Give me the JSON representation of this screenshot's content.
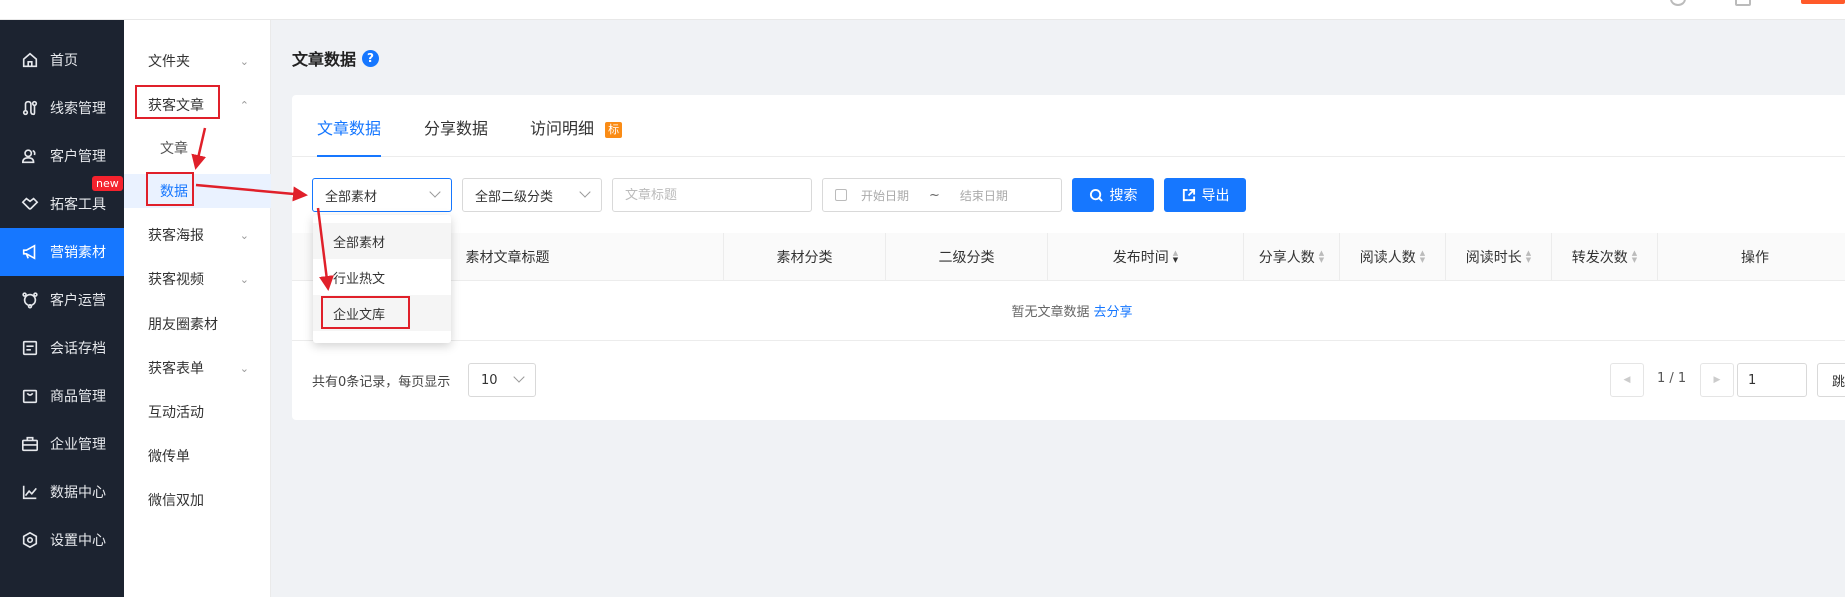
{
  "topbar": {},
  "nav": {
    "items": [
      {
        "label": "首页",
        "icon": "home-icon"
      },
      {
        "label": "线索管理",
        "icon": "route-icon"
      },
      {
        "label": "客户管理",
        "icon": "users-icon"
      },
      {
        "label": "拓客工具",
        "icon": "handshake-icon",
        "badge": "new"
      },
      {
        "label": "营销素材",
        "icon": "megaphone-icon",
        "active": true
      },
      {
        "label": "客户运营",
        "icon": "branch-icon"
      },
      {
        "label": "会话存档",
        "icon": "document-icon"
      },
      {
        "label": "商品管理",
        "icon": "bag-icon"
      },
      {
        "label": "企业管理",
        "icon": "briefcase-icon"
      },
      {
        "label": "数据中心",
        "icon": "chart-line-icon"
      },
      {
        "label": "设置中心",
        "icon": "settings-icon"
      }
    ]
  },
  "subnav": {
    "items": [
      {
        "label": "文件夹",
        "chevron": "down"
      },
      {
        "label": "获客文章",
        "chevron": "up"
      },
      {
        "label": "文章",
        "child": true
      },
      {
        "label": "数据",
        "child": true,
        "selected": true
      },
      {
        "label": "获客海报",
        "chevron": "down"
      },
      {
        "label": "获客视频",
        "chevron": "down"
      },
      {
        "label": "朋友圈素材"
      },
      {
        "label": "获客表单",
        "chevron": "down"
      },
      {
        "label": "互动活动"
      },
      {
        "label": "微传单"
      },
      {
        "label": "微信双加"
      }
    ]
  },
  "page": {
    "title": "文章数据",
    "help": "?"
  },
  "tabs": [
    {
      "label": "文章数据",
      "active": true
    },
    {
      "label": "分享数据"
    },
    {
      "label": "访问明细",
      "tag": "标"
    }
  ],
  "filters": {
    "category_value": "全部素材",
    "subcategory_value": "全部二级分类",
    "title_placeholder": "文章标题",
    "start_date_placeholder": "开始日期",
    "date_separator": "~",
    "end_date_placeholder": "结束日期",
    "search_label": "搜索",
    "export_label": "导出"
  },
  "dropdown": {
    "options": [
      "全部素材",
      "行业热文",
      "企业文库"
    ]
  },
  "table": {
    "columns": [
      "素材文章标题",
      "素材分类",
      "二级分类",
      "发布时间",
      "分享人数",
      "阅读人数",
      "阅读时长",
      "转发次数",
      "操作"
    ],
    "empty_text": "暂无文章数据",
    "empty_link": "去分享"
  },
  "pagination": {
    "summary": "共有0条记录，每页显示",
    "page_size": "10",
    "page_info": "1 / 1",
    "page_input": "1",
    "jump_label": "跳转"
  },
  "colors": {
    "primary": "#1677ff",
    "nav_bg": "#1c2330",
    "annotation": "#e0202a",
    "badge": "#f5222d",
    "tag": "#fa8c16"
  }
}
